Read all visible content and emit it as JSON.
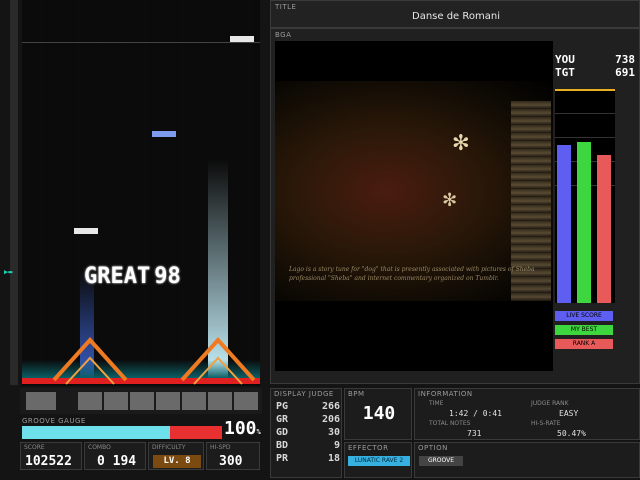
{
  "song": {
    "title_label": "TITLE",
    "title": "Danse de Romani",
    "bga_label": "BGA"
  },
  "lyrics": "Lago is a story tune for \"dog\" that is presently associated with pictures of Sheba professional \"Sheba\" and internet commentary organized on Tumblr.",
  "judge": {
    "text": "GREAT",
    "combo": "98"
  },
  "groove": {
    "label": "GROOVE GAUGE",
    "value": "100",
    "unit": "%",
    "fill": 0.74
  },
  "score": {
    "label": "SCORE",
    "value": "102522"
  },
  "combo": {
    "label": "COMBO",
    "value": "0 194"
  },
  "difficulty": {
    "label": "DIFFICULTY",
    "value": "LV. 8"
  },
  "hispeed": {
    "label": "HI-SPD",
    "value": "300"
  },
  "scoreboard": {
    "you_label": "YOU",
    "you": "738",
    "tgt_label": "TGT",
    "tgt": "691"
  },
  "graph": {
    "bars": [
      {
        "name": "LIVE SCORE",
        "fraction": 0.74,
        "color": "#5e5ef0"
      },
      {
        "name": "MY BEST",
        "fraction": 0.75,
        "color": "#3ed63e"
      },
      {
        "name": "RANK A",
        "fraction": 0.69,
        "color": "#e85a5a"
      }
    ]
  },
  "display_judge": {
    "label": "DISPLAY JUDGE",
    "rows": [
      {
        "k": "PG",
        "v": "266"
      },
      {
        "k": "GR",
        "v": "206"
      },
      {
        "k": "GD",
        "v": "30"
      },
      {
        "k": "BD",
        "v": "9"
      },
      {
        "k": "PR",
        "v": "18"
      }
    ]
  },
  "bpm": {
    "label": "BPM",
    "value": "140"
  },
  "effector": {
    "label": "EFFECTOR",
    "value": "LUNATIC RAVE 2"
  },
  "option": {
    "label": "OPTION",
    "value": "GROOVE"
  },
  "info": {
    "label": "INFORMATION",
    "time_label": "TIME",
    "time": "1:42 / 0:41",
    "judge_rank_label": "JUDGE RANK",
    "judge_rank": "EASY",
    "total_label": "TOTAL NOTES",
    "total": "731",
    "rate_label": "HI-S-RATE",
    "rate": "50.47%"
  }
}
